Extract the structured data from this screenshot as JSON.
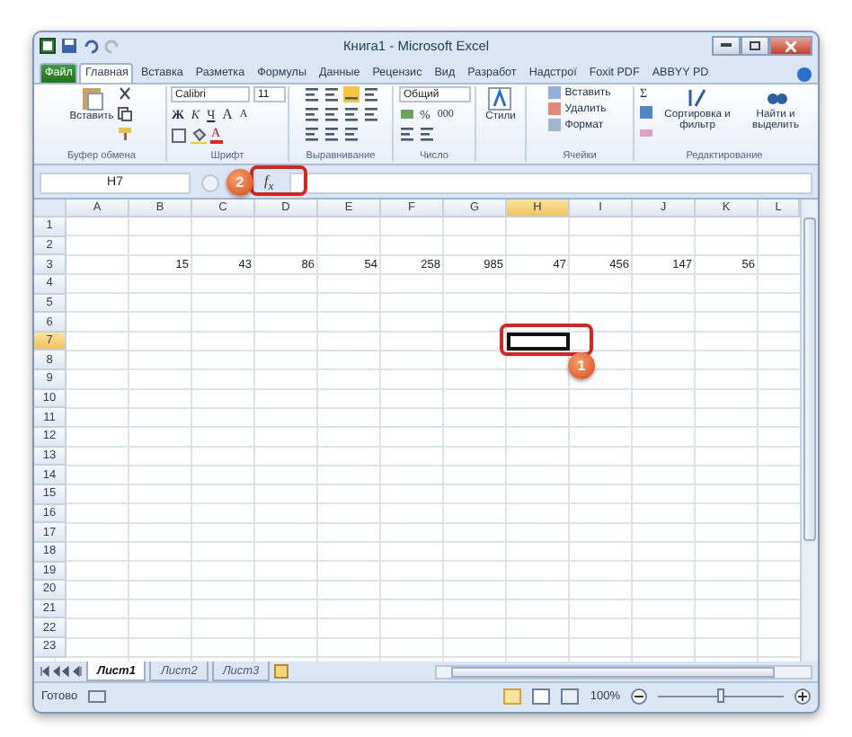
{
  "window": {
    "title": "Книга1 - Microsoft Excel"
  },
  "ribbon_tabs": [
    {
      "label": "Файл",
      "kind": "file",
      "selected": false
    },
    {
      "label": "Главная",
      "kind": "tab",
      "selected": true
    },
    {
      "label": "Вставка",
      "kind": "tab",
      "selected": false
    },
    {
      "label": "Разметка",
      "kind": "tab",
      "selected": false
    },
    {
      "label": "Формулы",
      "kind": "tab",
      "selected": false
    },
    {
      "label": "Данные",
      "kind": "tab",
      "selected": false
    },
    {
      "label": "Рецензис",
      "kind": "tab",
      "selected": false
    },
    {
      "label": "Вид",
      "kind": "tab",
      "selected": false
    },
    {
      "label": "Разработ",
      "kind": "tab",
      "selected": false
    },
    {
      "label": "Надстрої",
      "kind": "tab",
      "selected": false
    },
    {
      "label": "Foxit PDF",
      "kind": "tab",
      "selected": false
    },
    {
      "label": "ABBYY PD",
      "kind": "tab",
      "selected": false
    }
  ],
  "ribbon": {
    "clipboard": {
      "paste": "Вставить",
      "label": "Буфер обмена"
    },
    "font": {
      "name": "Calibri",
      "size": "11",
      "bold": "Ж",
      "italic": "К",
      "underline": "Ч",
      "grow": "A",
      "shrink": "A",
      "font_color": "A",
      "label": "Шрифт"
    },
    "alignment": {
      "label": "Выравнивание"
    },
    "number": {
      "format": "Общий",
      "percent": "%",
      "thousands": "000",
      "label": "Число"
    },
    "styles": {
      "button": "Стили"
    },
    "cells": {
      "insert": "Вставить",
      "delete": "Удалить",
      "format": "Формат",
      "label": "Ячейки"
    },
    "editing": {
      "sum": "Σ",
      "sort": "Сортировка и фильтр",
      "find": "Найти и выделить",
      "label": "Редактирование"
    }
  },
  "formula_bar": {
    "name_box": "H7",
    "function_button": "f$_{x}$"
  },
  "columns": [
    {
      "label": "A",
      "selected": false
    },
    {
      "label": "B",
      "selected": false
    },
    {
      "label": "C",
      "selected": false
    },
    {
      "label": "D",
      "selected": false
    },
    {
      "label": "E",
      "selected": false
    },
    {
      "label": "F",
      "selected": false
    },
    {
      "label": "G",
      "selected": false
    },
    {
      "label": "H",
      "selected": true
    },
    {
      "label": "I",
      "selected": false
    },
    {
      "label": "J",
      "selected": false
    },
    {
      "label": "K",
      "selected": false
    },
    {
      "label": "L",
      "selected": false
    }
  ],
  "rows": [
    {
      "label": "1",
      "selected": false
    },
    {
      "label": "2",
      "selected": false
    },
    {
      "label": "3",
      "selected": false,
      "cells": [
        null,
        "15",
        "43",
        "86",
        "54",
        "258",
        "985",
        "47",
        "456",
        "147",
        "56",
        null
      ]
    },
    {
      "label": "4",
      "selected": false
    },
    {
      "label": "5",
      "selected": false
    },
    {
      "label": "6",
      "selected": false
    },
    {
      "label": "7",
      "selected": true
    },
    {
      "label": "8",
      "selected": false
    },
    {
      "label": "9",
      "selected": false
    },
    {
      "label": "10",
      "selected": false
    },
    {
      "label": "11",
      "selected": false
    },
    {
      "label": "12",
      "selected": false
    },
    {
      "label": "13",
      "selected": false
    },
    {
      "label": "14",
      "selected": false
    },
    {
      "label": "15",
      "selected": false
    },
    {
      "label": "16",
      "selected": false
    },
    {
      "label": "17",
      "selected": false
    },
    {
      "label": "18",
      "selected": false
    },
    {
      "label": "19",
      "selected": false
    },
    {
      "label": "20",
      "selected": false
    },
    {
      "label": "21",
      "selected": false
    },
    {
      "label": "22",
      "selected": false
    },
    {
      "label": "23",
      "selected": false
    }
  ],
  "sheet_tabs": [
    {
      "label": "Лист1",
      "selected": true
    },
    {
      "label": "Лист2",
      "selected": false
    },
    {
      "label": "Лист3",
      "selected": false
    }
  ],
  "status_bar": {
    "status": "Готово",
    "zoom": "100%",
    "zoom_level": {
      "level": 0.5
    }
  },
  "callouts": [
    {
      "label": "2"
    },
    {
      "label": "1"
    }
  ]
}
